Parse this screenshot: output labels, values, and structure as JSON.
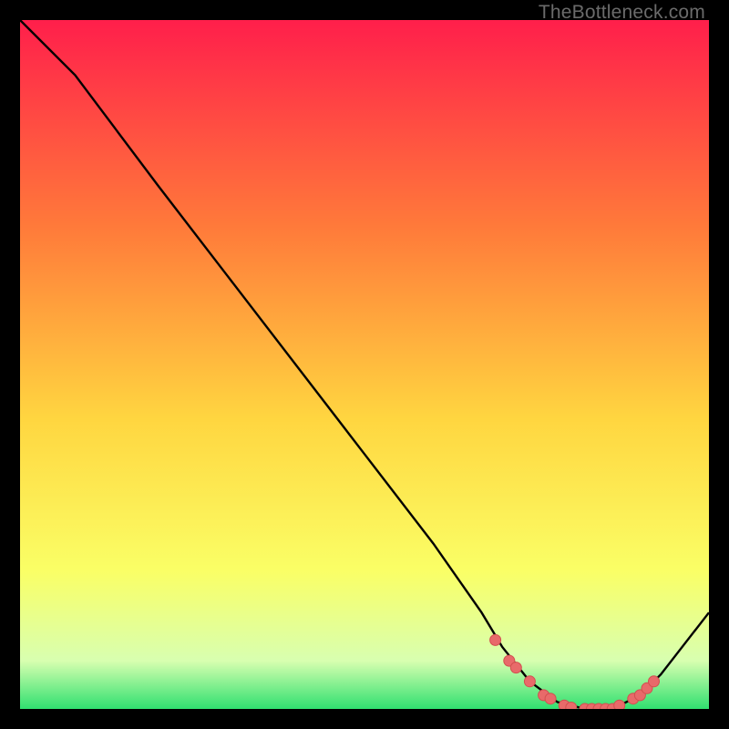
{
  "watermark": "TheBottleneck.com",
  "colors": {
    "gradient_top": "#ff1f4b",
    "gradient_mid1": "#ff7a3a",
    "gradient_mid2": "#ffd640",
    "gradient_mid3": "#faff66",
    "gradient_bottom1": "#d8ffb0",
    "gradient_bottom2": "#30e070",
    "curve": "#000000",
    "point_fill": "#e86a6a",
    "point_stroke": "#d24f4f"
  },
  "chart_data": {
    "type": "line",
    "title": "",
    "xlabel": "",
    "ylabel": "",
    "xlim": [
      0,
      100
    ],
    "ylim": [
      0,
      100
    ],
    "series": [
      {
        "name": "bottleneck-curve",
        "x": [
          0,
          8,
          20,
          30,
          40,
          50,
          60,
          67,
          70,
          74,
          78,
          82,
          86,
          90,
          93,
          100
        ],
        "y": [
          100,
          92,
          76,
          63,
          50,
          37,
          24,
          14,
          9,
          4,
          1,
          0,
          0,
          2,
          5,
          14
        ]
      }
    ],
    "points": {
      "name": "highlight-points",
      "x": [
        69,
        71,
        72,
        74,
        76,
        77,
        79,
        80,
        82,
        83,
        84,
        85,
        86,
        87,
        89,
        90,
        91,
        92
      ],
      "y": [
        10,
        7,
        6,
        4,
        2,
        1.5,
        0.5,
        0.2,
        0,
        0,
        0,
        0,
        0,
        0.5,
        1.5,
        2,
        3,
        4
      ]
    }
  }
}
